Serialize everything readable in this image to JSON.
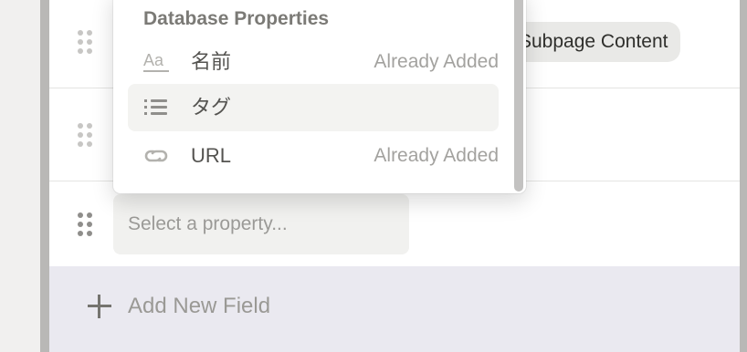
{
  "rows": [
    {
      "chip_label": "Subpage Content"
    },
    {},
    {
      "placeholder": "Select a property..."
    }
  ],
  "add_field": {
    "label": "Add New Field"
  },
  "dropdown": {
    "title": "Database Properties",
    "items": [
      {
        "icon": "text-type-icon",
        "label": "名前",
        "status": "Already Added"
      },
      {
        "icon": "list-icon",
        "label": "タグ",
        "status": ""
      },
      {
        "icon": "link-icon",
        "label": "URL",
        "status": "Already Added"
      }
    ]
  },
  "colors": {
    "panel_border": "#b9b8b6",
    "add_area_bg": "#eae9f0",
    "chip_bg": "#e9e9e7",
    "hover_bg": "#f3f3f1"
  }
}
